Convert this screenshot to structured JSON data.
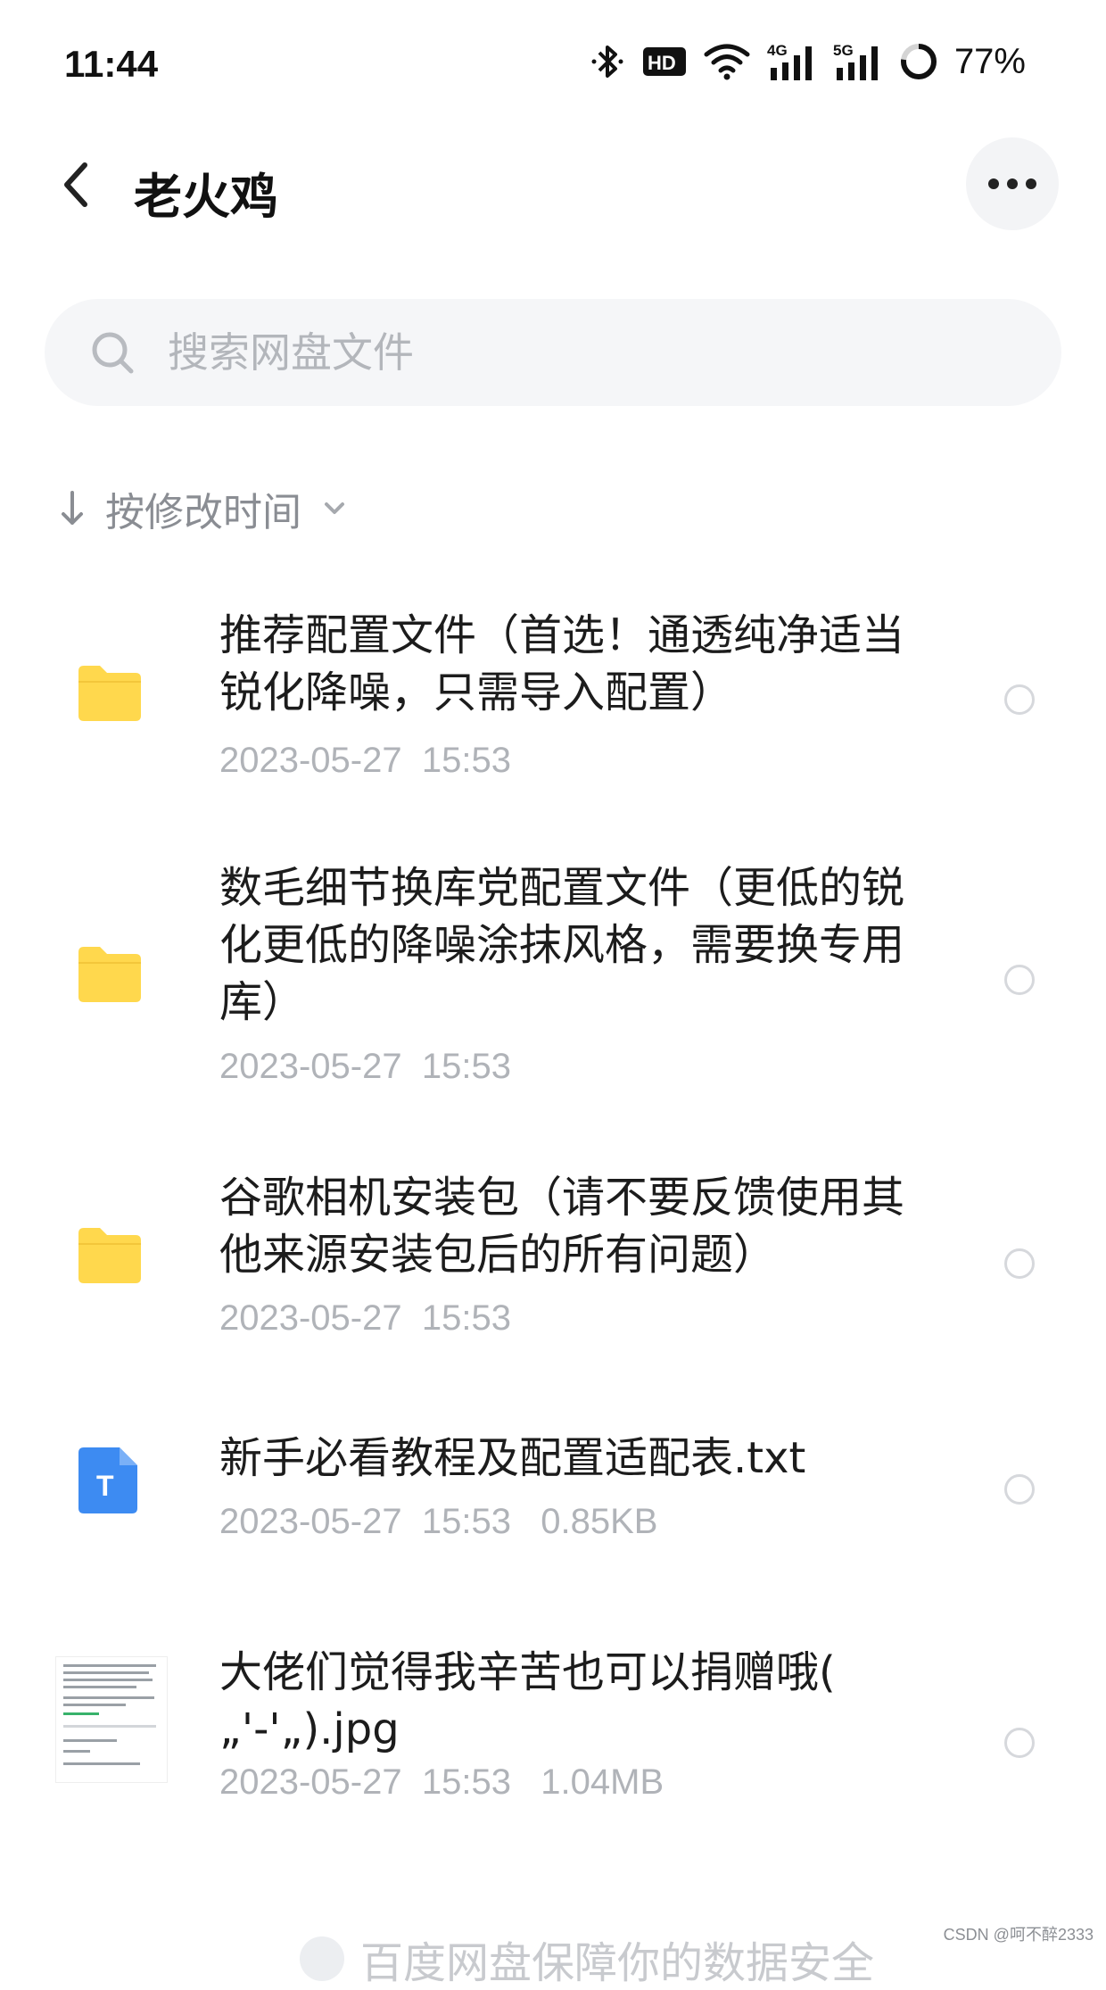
{
  "status_bar": {
    "time": "11:44",
    "icons": [
      "bluetooth-icon",
      "hd-icon",
      "wifi-icon",
      "signal-4g-icon",
      "signal-5g-icon",
      "battery-ring-icon"
    ],
    "hd_text": "HD",
    "net1": "4G",
    "net2": "5G",
    "battery": "77%"
  },
  "header": {
    "title": "老火鸡",
    "back_icon": "chevron-left-icon",
    "more_icon": "more-dots-icon"
  },
  "search": {
    "placeholder": "搜索网盘文件",
    "icon": "search-icon"
  },
  "sort": {
    "label": "按修改时间",
    "arrow_icon": "arrow-down-icon",
    "chevron_icon": "chevron-down-icon"
  },
  "files": [
    {
      "type": "folder",
      "name": "推荐配置文件（首选！通透纯净适当锐化降噪，只需导入配置）",
      "meta": "2023-05-27  15:53"
    },
    {
      "type": "folder",
      "name": "数毛细节换库党配置文件（更低的锐化更低的降噪涂抹风格，需要换专用库）",
      "meta": "2023-05-27  15:53"
    },
    {
      "type": "folder",
      "name": "谷歌相机安装包（请不要反馈使用其他来源安装包后的所有问题）",
      "meta": "2023-05-27  15:53"
    },
    {
      "type": "txt",
      "icon_letter": "T",
      "name": "新手必看教程及配置适配表.txt",
      "meta": "2023-05-27  15:53   0.85KB"
    },
    {
      "type": "image",
      "name": "大佬们觉得我辛苦也可以捐赠哦( „'-'„).jpg",
      "meta": "2023-05-27  15:53   1.04MB"
    }
  ],
  "footer_note": "百度网盘保障你的数据安全",
  "watermark": "CSDN @呵不醉2333",
  "colors": {
    "folder": "#FFD84D",
    "txt_icon": "#3D8BF2",
    "meta_text": "#B0B3B8"
  }
}
